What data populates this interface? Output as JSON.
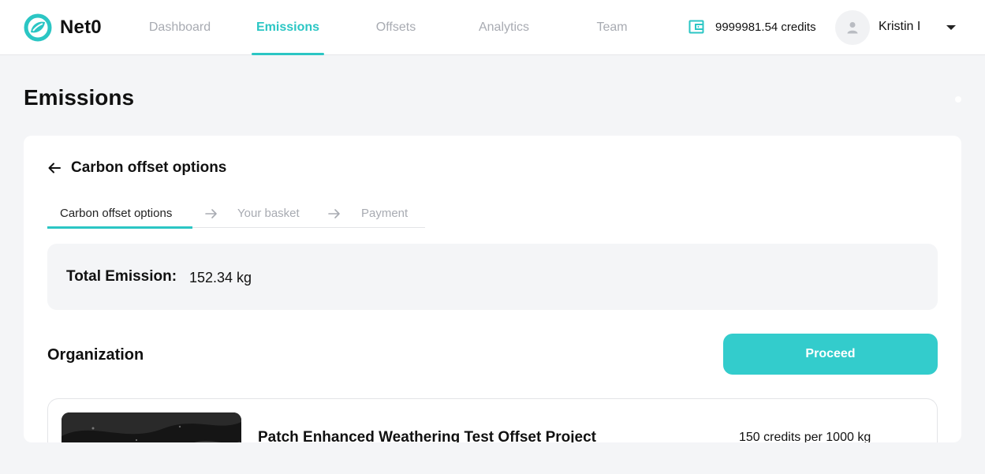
{
  "app": {
    "name": "Net0"
  },
  "nav": {
    "tabs": [
      {
        "label": "Dashboard",
        "active": false
      },
      {
        "label": "Emissions",
        "active": true
      },
      {
        "label": "Offsets",
        "active": false
      },
      {
        "label": "Analytics",
        "active": false
      },
      {
        "label": "Team",
        "active": false
      }
    ]
  },
  "account": {
    "credits_text": "9999981.54 credits",
    "user_name": "Kristin I"
  },
  "page": {
    "title": "Emissions"
  },
  "card": {
    "back_title": "Carbon offset options",
    "steps": [
      {
        "label": "Carbon offset options",
        "active": true
      },
      {
        "label": "Your basket",
        "active": false
      },
      {
        "label": "Payment",
        "active": false
      }
    ],
    "total_emission_label": "Total Emission:",
    "total_emission_value": "152.34 kg",
    "organization_title": "Organization",
    "proceed_label": "Proceed",
    "project": {
      "name": "Patch Enhanced Weathering Test Offset Project",
      "price": "150 credits per 1000 kg"
    }
  },
  "colors": {
    "accent": "#2bc6c4",
    "button": "#33cccc",
    "muted_text": "#a8abb2"
  },
  "icons": {
    "logo": "net0-logo-icon",
    "wallet": "wallet-icon",
    "avatar": "user-avatar-icon",
    "caret": "chevron-down-icon",
    "back": "arrow-left-icon",
    "step_separator": "arrow-right-icon"
  }
}
